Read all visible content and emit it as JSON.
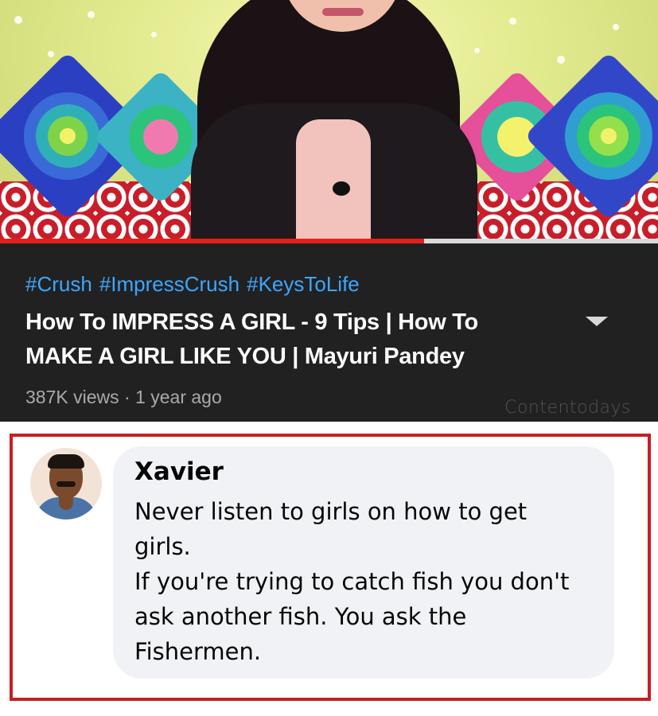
{
  "video": {
    "progress_fraction": 0.645,
    "hashtags": [
      "#Crush",
      "#ImpressCrush",
      "#KeysToLife"
    ],
    "title": "How To IMPRESS A GIRL - 9 Tips | How To MAKE A GIRL LIKE YOU | Mayuri Pandey",
    "meta": "387K views · 1 year ago",
    "watermark": "Contentodays"
  },
  "comment": {
    "author": "Xavier",
    "lines": [
      "Never listen to girls on how to get",
      "girls.",
      "If you're trying to catch fish you don't",
      "ask another fish. You ask the",
      "Fishermen."
    ]
  },
  "colors": {
    "hashtag": "#3ea6ff",
    "panel_bg": "#212121",
    "progress": "#e2211c",
    "highlight_border": "#c91d22",
    "bubble_bg": "#f0f2f5"
  }
}
